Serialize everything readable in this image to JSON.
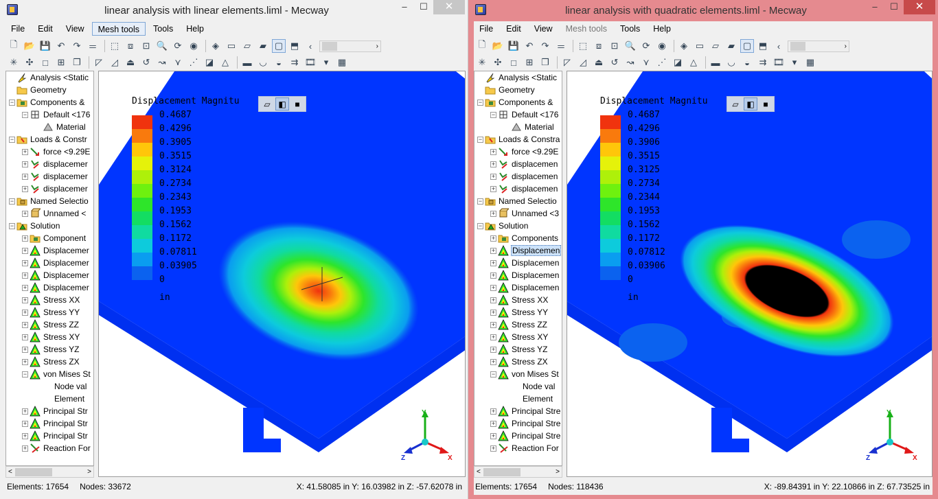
{
  "left": {
    "title": "linear analysis with linear elements.liml - Mecway",
    "menu": [
      "File",
      "Edit",
      "View",
      "Mesh tools",
      "Tools",
      "Help"
    ],
    "tree": [
      {
        "label": "Analysis <Static",
        "icon": "analysis"
      },
      {
        "label": "Geometry",
        "icon": "folder"
      },
      {
        "label": "Components &",
        "icon": "components"
      },
      {
        "label": "Default <176",
        "icon": "component"
      },
      {
        "label": "Material",
        "icon": "material"
      },
      {
        "label": "Loads & Constr",
        "icon": "loads"
      },
      {
        "label": "force <9.29E",
        "icon": "force"
      },
      {
        "label": "displacemer",
        "icon": "constraint"
      },
      {
        "label": "displacemer",
        "icon": "constraint"
      },
      {
        "label": "displacemer",
        "icon": "constraint"
      },
      {
        "label": "Named Selectio",
        "icon": "named"
      },
      {
        "label": "Unnamed <",
        "icon": "unnamed"
      },
      {
        "label": "Solution",
        "icon": "solution"
      },
      {
        "label": "Component",
        "icon": "components"
      },
      {
        "label": "Displacemer",
        "icon": "result"
      },
      {
        "label": "Displacemer",
        "icon": "result"
      },
      {
        "label": "Displacemer",
        "icon": "result"
      },
      {
        "label": "Displacemer",
        "icon": "result"
      },
      {
        "label": "Stress XX",
        "icon": "result"
      },
      {
        "label": "Stress YY",
        "icon": "result"
      },
      {
        "label": "Stress ZZ",
        "icon": "result"
      },
      {
        "label": "Stress XY",
        "icon": "result"
      },
      {
        "label": "Stress YZ",
        "icon": "result"
      },
      {
        "label": "Stress ZX",
        "icon": "result"
      },
      {
        "label": "von Mises St",
        "icon": "result"
      },
      {
        "label": "Node val",
        "icon": "none"
      },
      {
        "label": "Element",
        "icon": "none"
      },
      {
        "label": "Principal Str",
        "icon": "result"
      },
      {
        "label": "Principal Str",
        "icon": "result"
      },
      {
        "label": "Principal Str",
        "icon": "result"
      },
      {
        "label": "Reaction For",
        "icon": "reaction"
      }
    ],
    "legend": {
      "title": "Displacement Magnitu",
      "values": [
        "0.4687",
        "0.4296",
        "0.3905",
        "0.3515",
        "0.3124",
        "0.2734",
        "0.2343",
        "0.1953",
        "0.1562",
        "0.1172",
        "0.07811",
        "0.03905",
        "0"
      ],
      "unit": "in"
    },
    "status": {
      "elements": "Elements:  17654",
      "nodes": "Nodes:  33672",
      "coords": "X: 41.58085 in Y: 16.03982 in Z: -57.62078 in"
    }
  },
  "right": {
    "title": "linear analysis with quadratic elements.liml - Mecway",
    "menu": [
      "File",
      "Edit",
      "View",
      "Mesh tools",
      "Tools",
      "Help"
    ],
    "tree": [
      {
        "label": "Analysis <Static",
        "icon": "analysis"
      },
      {
        "label": "Geometry",
        "icon": "folder"
      },
      {
        "label": "Components &",
        "icon": "components"
      },
      {
        "label": "Default <176",
        "icon": "component"
      },
      {
        "label": "Material",
        "icon": "material"
      },
      {
        "label": "Loads & Constra",
        "icon": "loads"
      },
      {
        "label": "force <9.29E",
        "icon": "force"
      },
      {
        "label": "displacemen",
        "icon": "constraint"
      },
      {
        "label": "displacemen",
        "icon": "constraint"
      },
      {
        "label": "displacemen",
        "icon": "constraint"
      },
      {
        "label": "Named Selectio",
        "icon": "named"
      },
      {
        "label": "Unnamed <3",
        "icon": "unnamed"
      },
      {
        "label": "Solution",
        "icon": "solution"
      },
      {
        "label": "Components",
        "icon": "components"
      },
      {
        "label": "Displacemen",
        "icon": "result"
      },
      {
        "label": "Displacemen",
        "icon": "result"
      },
      {
        "label": "Displacemen",
        "icon": "result"
      },
      {
        "label": "Displacemen",
        "icon": "result"
      },
      {
        "label": "Stress XX",
        "icon": "result"
      },
      {
        "label": "Stress YY",
        "icon": "result"
      },
      {
        "label": "Stress ZZ",
        "icon": "result"
      },
      {
        "label": "Stress XY",
        "icon": "result"
      },
      {
        "label": "Stress YZ",
        "icon": "result"
      },
      {
        "label": "Stress ZX",
        "icon": "result"
      },
      {
        "label": "von Mises St",
        "icon": "result"
      },
      {
        "label": "Node val",
        "icon": "none"
      },
      {
        "label": "Element",
        "icon": "none"
      },
      {
        "label": "Principal Stre",
        "icon": "result"
      },
      {
        "label": "Principal Stre",
        "icon": "result"
      },
      {
        "label": "Principal Stre",
        "icon": "result"
      },
      {
        "label": "Reaction For",
        "icon": "reaction"
      }
    ],
    "legend": {
      "title": "Displacement Magnitu",
      "values": [
        "0.4687",
        "0.4296",
        "0.3906",
        "0.3515",
        "0.3125",
        "0.2734",
        "0.2344",
        "0.1953",
        "0.1562",
        "0.1172",
        "0.07812",
        "0.03906",
        "0"
      ],
      "unit": "in"
    },
    "status": {
      "elements": "Elements:  17654",
      "nodes": "Nodes:  118436",
      "coords": "X: -89.84391 in Y: 22.10866 in Z: 67.73525 in"
    }
  },
  "legend_colors": [
    "#f0330e",
    "#f97a0d",
    "#ffc60a",
    "#e5f20a",
    "#aef00a",
    "#6ef10f",
    "#2ee52a",
    "#13dd62",
    "#10dba0",
    "#0dcbdc",
    "#0a9df0",
    "#0b62ef"
  ],
  "model_color": "#0035ff",
  "axes": {
    "x": "X",
    "y": "Y",
    "z": "Z"
  },
  "titlebar_buttons": {
    "min": "–",
    "max": "☐",
    "close": "✕"
  }
}
